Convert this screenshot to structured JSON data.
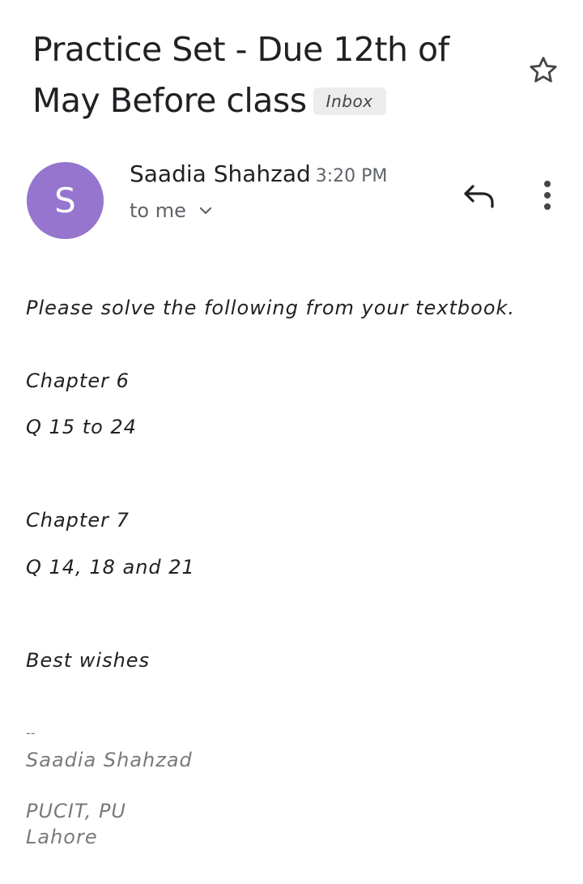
{
  "subject": {
    "line1": "Practice Set - Due 12th of",
    "line2": "May Before class",
    "label_badge": "Inbox"
  },
  "sender": {
    "avatar_letter": "S",
    "avatar_color": "#9575cd",
    "name": "Saadia Shahzad",
    "time": "3:20 PM",
    "recipient": "to me"
  },
  "icons": {
    "star": "star-outline-icon",
    "reply": "reply-icon",
    "more": "more-vert-icon",
    "expand": "chevron-down-icon"
  },
  "body": {
    "intro": "Please solve the following from your textbook.",
    "chapter1_title": "Chapter 6",
    "chapter1_questions": "Q 15 to 24",
    "chapter2_title": "Chapter 7",
    "chapter2_questions": "Q 14, 18 and 21",
    "closing": "Best wishes"
  },
  "signature": {
    "separator": "--",
    "name": "Saadia Shahzad",
    "affiliation": "PUCIT, PU",
    "city": "Lahore"
  }
}
